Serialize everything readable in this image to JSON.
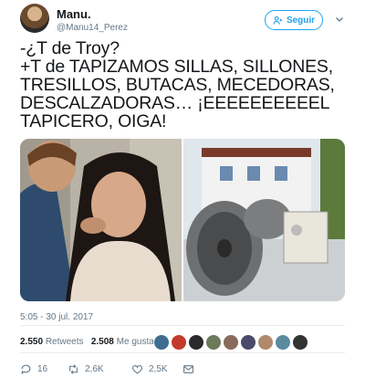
{
  "user": {
    "name": "Manu.",
    "handle": "@Manu14_Perez"
  },
  "follow_label": "Seguir",
  "tweet_lines": [
    "-¿T de Troy?",
    "+T de TAPIZAMOS SILLAS, SILLONES,",
    "TRESILLOS, BUTACAS, MECEDORAS,",
    "DESCALZADORAS… ¡EEEEEEEEEEL",
    "TAPICERO, OIGA!"
  ],
  "timestamp": "5:05 - 30 jul. 2017",
  "retweets": {
    "count": "2.550",
    "label": "Retweets"
  },
  "likes": {
    "count": "2.508",
    "label": "Me gusta"
  },
  "actions": {
    "replies": "16",
    "retweets": "2,6K",
    "likes": "2,5K"
  },
  "colors": {
    "accent": "#1da1f2",
    "muted": "#657786",
    "text": "#14171a"
  },
  "icons": [
    "user-plus-icon",
    "chevron-down-icon",
    "reply-icon",
    "retweet-icon",
    "heart-icon",
    "message-icon"
  ]
}
